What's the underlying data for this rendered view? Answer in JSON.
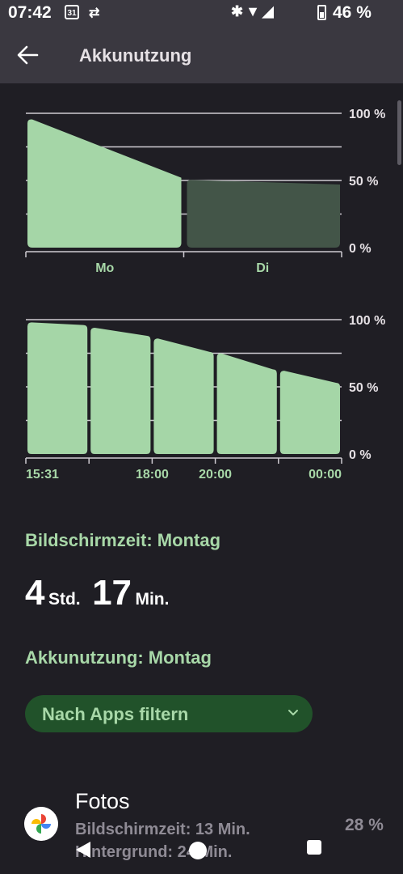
{
  "status_bar": {
    "time": "07:42",
    "calendar_day": "31",
    "battery_percent": "46 %",
    "icons": [
      "sync-off-icon",
      "bluetooth-icon",
      "wifi-icon",
      "signal-icon",
      "battery-icon"
    ]
  },
  "app_bar": {
    "title": "Akkunutzung",
    "back_icon": "arrow-left-icon"
  },
  "chart_data": [
    {
      "type": "area",
      "y_ticks": [
        "100 %",
        "50 %",
        "0 %"
      ],
      "ylim": [
        0,
        100
      ],
      "x_labels": [
        "Mo",
        "Di"
      ],
      "series": [
        {
          "segment": "Mo",
          "x": [
            0,
            1
          ],
          "y": [
            96,
            52
          ],
          "highlighted": true
        },
        {
          "segment": "Di",
          "x": [
            1,
            2
          ],
          "y": [
            51,
            47
          ],
          "highlighted": false
        }
      ],
      "colors": {
        "active": "#a5d6a7",
        "inactive": "#435548"
      }
    },
    {
      "type": "area",
      "y_ticks": [
        "100 %",
        "50 %",
        "0 %"
      ],
      "ylim": [
        0,
        100
      ],
      "x_labels": [
        "15:31",
        "18:00",
        "20:00",
        "00:00"
      ],
      "bars": [
        {
          "y_start": 98,
          "y_end": 96
        },
        {
          "y_start": 94,
          "y_end": 88
        },
        {
          "y_start": 86,
          "y_end": 76
        },
        {
          "y_start": 75,
          "y_end": 63
        },
        {
          "y_start": 62,
          "y_end": 53
        }
      ],
      "colors": {
        "active": "#a5d6a7"
      }
    }
  ],
  "screen_time": {
    "label": "Bildschirmzeit: Montag",
    "hours": "4",
    "hours_unit": "Std.",
    "minutes": "17",
    "minutes_unit": "Min."
  },
  "battery_usage": {
    "label": "Akkunutzung: Montag"
  },
  "filter": {
    "label": "Nach Apps filtern",
    "icon": "chevron-down-icon"
  },
  "apps": [
    {
      "name": "Fotos",
      "line1": "Bildschirmzeit: 13 Min.",
      "line2": "Hintergrund: 24 Min.",
      "percent": "28 %",
      "icon": "google-photos-icon"
    }
  ],
  "nav_bar": {
    "icons": [
      "nav-back-icon",
      "nav-home-icon",
      "nav-recents-icon"
    ]
  }
}
